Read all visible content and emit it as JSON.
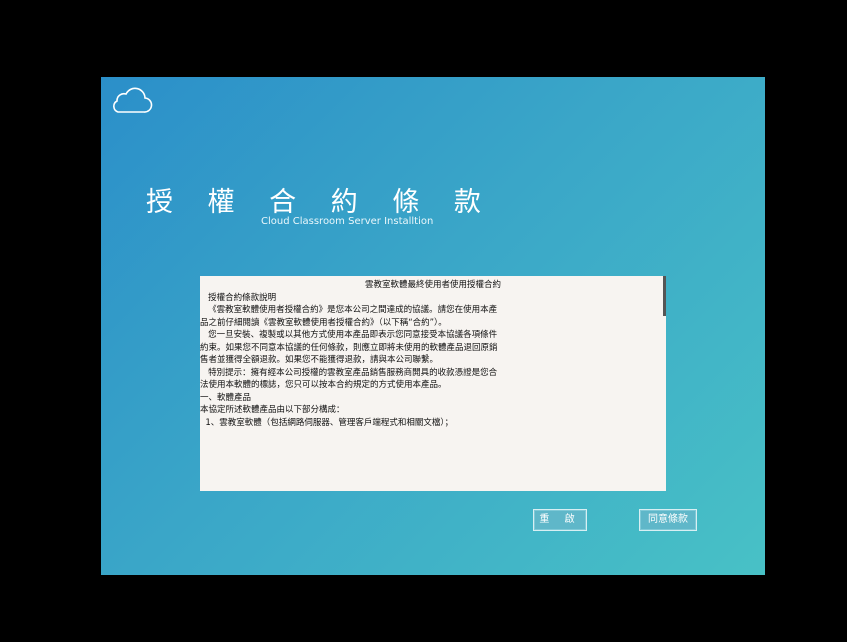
{
  "title": "授 權 合 約 條 款",
  "subtitle": "Cloud Classroom Server Installtion",
  "license": {
    "header": "雲教室軟體最終使用者使用授權合約",
    "lines": [
      "",
      "   授權合約條款說明",
      "",
      "   《雲教室軟體使用者授權合約》是您本公司之間達成的協議。請您在使用本產",
      "品之前仔細閱讀《雲教室軟體使用者授權合約》（以下稱“合約”）。",
      "   您一旦安裝、複製或以其他方式使用本產品即表示您同意接受本協議各項條件",
      "約束。如果您不同意本協議的任何條款，則應立即將未使用的軟體產品退回原銷",
      "售者並獲得全額退款。如果您不能獲得退款，請與本公司聯繫。",
      "   特別提示：擁有經本公司授權的雲教室產品銷售服務商開具的收款憑證是您合",
      "法使用本軟體的標誌，您只可以按本合約規定的方式使用本產品。",
      "",
      "一、軟體產品",
      "",
      "本協定所述軟體產品由以下部分構成：",
      "  1、雲教室軟體（包括網路伺服器、管理客戶端程式和相關文檔）；"
    ]
  },
  "buttons": {
    "reset": "重 啟",
    "agree": "同意條款"
  },
  "icons": {
    "logo": "cloud-icon"
  }
}
